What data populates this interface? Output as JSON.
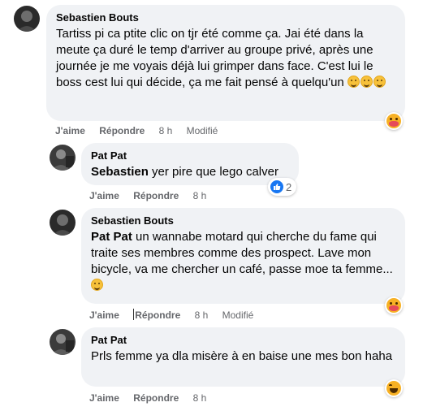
{
  "comments": [
    {
      "author": "Sebastien Bouts",
      "text": "Tartiss pi ca ptite clic on tjr été comme ça. Jai été dans la meute ça duré le temp d'arriver au groupe privé, après une journée je me voyais déjà lui grimper dans face. C'est lui le boss cest lui qui décide, ça me fait pensé à quelqu'un",
      "emojis": [
        "thinking-face",
        "thinking-face",
        "rolling-laughing-face"
      ],
      "like_label": "J'aime",
      "reply_label": "Répondre",
      "time": "8 h",
      "edited": "Modifié",
      "reaction": "care-reaction"
    },
    {
      "author": "Pat Pat",
      "mention": "Sebastien",
      "text": " yer pire que lego calver",
      "like_label": "J'aime",
      "reply_label": "Répondre",
      "time": "8 h",
      "reaction": "like-reaction",
      "reaction_count": "2"
    },
    {
      "author": "Sebastien Bouts",
      "mention": "Pat Pat",
      "text": " un wannabe motard qui cherche du fame qui traite ses membres comme des prospect. Lave mon bicycle, va me chercher un café, passe moe ta femme...",
      "emojis": [
        "laughing-face"
      ],
      "like_label": "J'aime",
      "reply_label": "Répondre",
      "time": "8 h",
      "edited": "Modifié",
      "reaction": "care-reaction"
    },
    {
      "author": "Pat Pat",
      "text": "Prls femme ya dla misère à en baise une mes bon haha",
      "like_label": "J'aime",
      "reply_label": "Répondre",
      "time": "8 h",
      "reaction": "haha-reaction"
    }
  ],
  "colors": {
    "bubble": "#f0f2f5",
    "meta": "#65676b",
    "like_blue": "#1877f2"
  }
}
